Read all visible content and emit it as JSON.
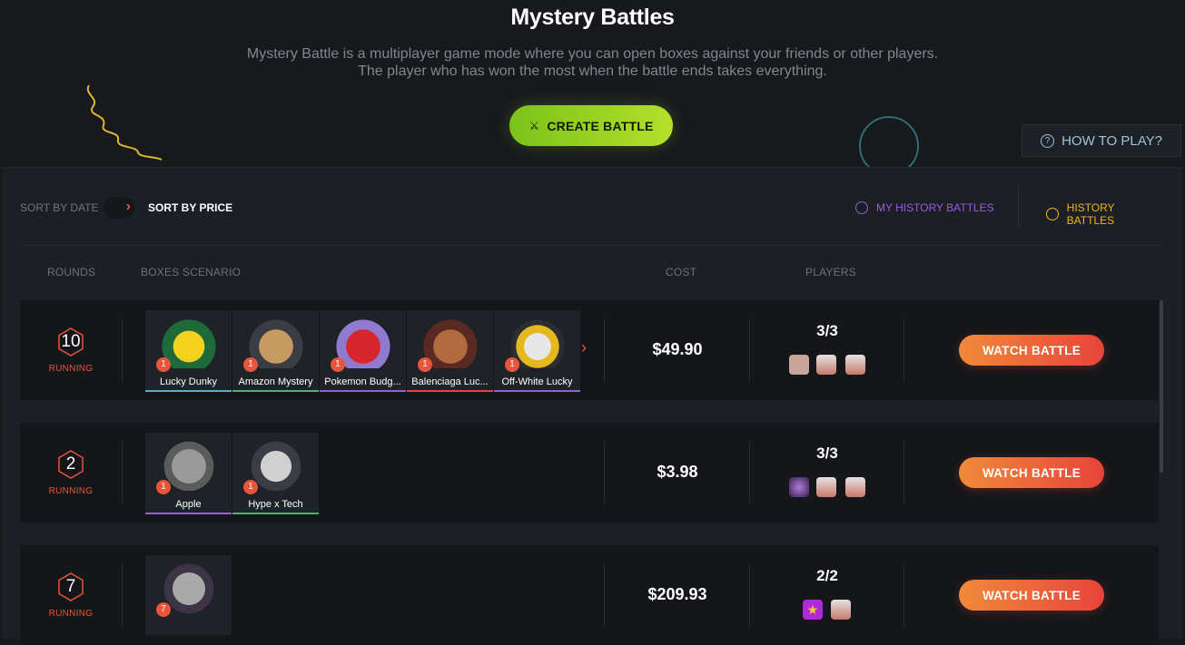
{
  "header": {
    "title": "Mystery Battles",
    "subtitle_line1": "Mystery Battle is a multiplayer game mode where you can open boxes against your friends or other players.",
    "subtitle_line2": "The player who has won the most when the battle ends takes everything.",
    "create_label": "CREATE BATTLE",
    "howto_label": "HOW TO PLAY?"
  },
  "sort": {
    "by_date": "SORT BY DATE",
    "by_price": "SORT BY PRICE",
    "active": "price"
  },
  "history": {
    "my_history": "MY HISTORY BATTLES",
    "history": "HISTORY BATTLES"
  },
  "columns": {
    "rounds": "ROUNDS",
    "boxes": "BOXES SCENARIO",
    "cost": "COST",
    "players": "PLAYERS"
  },
  "colors": {
    "accent_green": "#8fd21f",
    "accent_orange": "#e8553a",
    "history_purple": "#9b59e6",
    "history_yellow": "#f0b41c"
  },
  "battles": [
    {
      "rounds": "10",
      "status": "RUNNING",
      "boxes": [
        {
          "name": "Lucky Dunky",
          "count": "1",
          "color": "#4ab3d6"
        },
        {
          "name": "Amazon Mystery",
          "count": "1",
          "color": "#3fb871"
        },
        {
          "name": "Pokemon Budg...",
          "count": "1",
          "color": "#9b59e6"
        },
        {
          "name": "Balenciaga Luc...",
          "count": "1",
          "color": "#e0463a"
        },
        {
          "name": "Off-White Lucky",
          "count": "1",
          "color": "#9b59e6"
        }
      ],
      "cost": "$49.90",
      "players": "3/3",
      "avatar_icons": [
        "user-avatar",
        "box-avatar",
        "box-avatar"
      ],
      "action": "WATCH BATTLE"
    },
    {
      "rounds": "2",
      "status": "RUNNING",
      "boxes": [
        {
          "name": "Apple",
          "count": "1",
          "color": "#9b59e6"
        },
        {
          "name": "Hype x Tech",
          "count": "1",
          "color": "#3fb871"
        }
      ],
      "cost": "$3.98",
      "players": "3/3",
      "avatar_icons": [
        "user-avatar",
        "box-avatar",
        "box-avatar"
      ],
      "action": "WATCH BATTLE"
    },
    {
      "rounds": "7",
      "status": "RUNNING",
      "boxes": [
        {
          "name": "",
          "count": "7",
          "color": "#141619"
        }
      ],
      "cost": "$209.93",
      "players": "2/2",
      "avatar_icons": [
        "star-avatar",
        "box-avatar"
      ],
      "action": "WATCH BATTLE"
    }
  ]
}
